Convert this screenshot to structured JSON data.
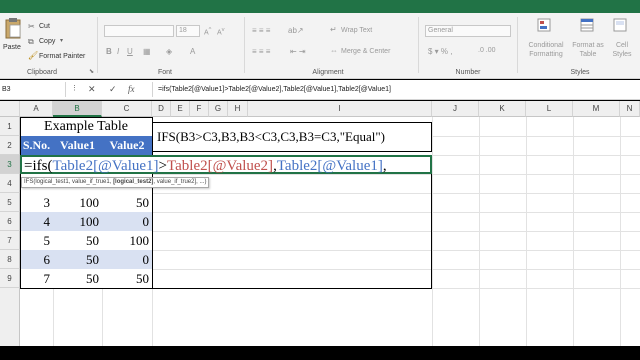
{
  "ribbon": {
    "clipboard": {
      "paste_label": "Paste",
      "cut_label": "Cut",
      "copy_label": "Copy",
      "format_painter_label": "Format Painter",
      "group_label": "Clipboard"
    },
    "font": {
      "font_size": "18",
      "group_label": "Font",
      "bold": "B",
      "italic": "I",
      "underline": "U"
    },
    "alignment": {
      "wrap_text_label": "Wrap Text",
      "merge_center_label": "Merge & Center",
      "group_label": "Alignment"
    },
    "number": {
      "format_value": "General",
      "group_label": "Number"
    },
    "styles": {
      "conditional_formatting_label": "Conditional Formatting",
      "format_as_table_label": "Format as Table",
      "cell_styles_label": "Cell Styles",
      "group_label": "Styles"
    }
  },
  "formula_bar": {
    "name_box": "B3",
    "fx": "fx",
    "formula": "=ifs(Table2[@Value1]>Table2[@Value2],Table2[@Value1],Table2[@Value1]"
  },
  "columns": [
    "A",
    "B",
    "C",
    "D",
    "E",
    "F",
    "G",
    "H",
    "I",
    "J",
    "K",
    "L",
    "M",
    "N"
  ],
  "rows": [
    "1",
    "2",
    "3",
    "4",
    "5",
    "6",
    "7",
    "8",
    "9"
  ],
  "table": {
    "title": "Example Table",
    "headers": [
      "S.No.",
      "Value1",
      "Value2"
    ],
    "data_rows": [
      [
        "3",
        "100",
        "50"
      ],
      [
        "4",
        "100",
        "0"
      ],
      [
        "5",
        "50",
        "100"
      ],
      [
        "6",
        "50",
        "0"
      ],
      [
        "7",
        "50",
        "50"
      ]
    ]
  },
  "ifs_example": "IFS(B3>C3,B3,B3<C3,C3,B3=C3,\"Equal\")",
  "editing_cell": {
    "prefix": "=ifs(",
    "part1": "Table2[@Value1]",
    "op": ">",
    "part2": "Table2[@Value2]",
    "sep1": ",",
    "part3": "Table2[@Value1]",
    "sep2": ","
  },
  "tooltip": {
    "fn": "IFS(logical_test1, value_if_true1, ",
    "current_arg": "[logical_test2]",
    "rest": ", value_if_true2], ...)"
  },
  "colors": {
    "excel_green": "#217346",
    "table_header": "#4472c4",
    "table_band": "#d9e1f2",
    "ref_red": "#c0504d"
  }
}
